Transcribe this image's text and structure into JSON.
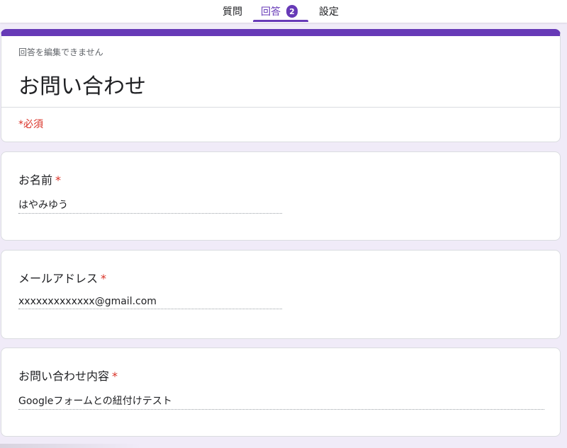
{
  "tabs": {
    "questions": "質問",
    "responses": "回答",
    "responses_badge": "2",
    "settings": "設定"
  },
  "form": {
    "note": "回答を編集できません",
    "title": "お問い合わせ",
    "required_note": "*必須"
  },
  "questions": [
    {
      "label": "お名前",
      "required_mark": "*",
      "answer": "はやみゆう"
    },
    {
      "label": "メールアドレス",
      "required_mark": "*",
      "answer": "xxxxxxxxxxxxx@gmail.com"
    },
    {
      "label": "お問い合わせ内容",
      "required_mark": "*",
      "answer": "Googleフォームとの紐付けテスト"
    }
  ],
  "colors": {
    "accent": "#673ab7",
    "background": "#f0ebf8",
    "required": "#d93025"
  }
}
